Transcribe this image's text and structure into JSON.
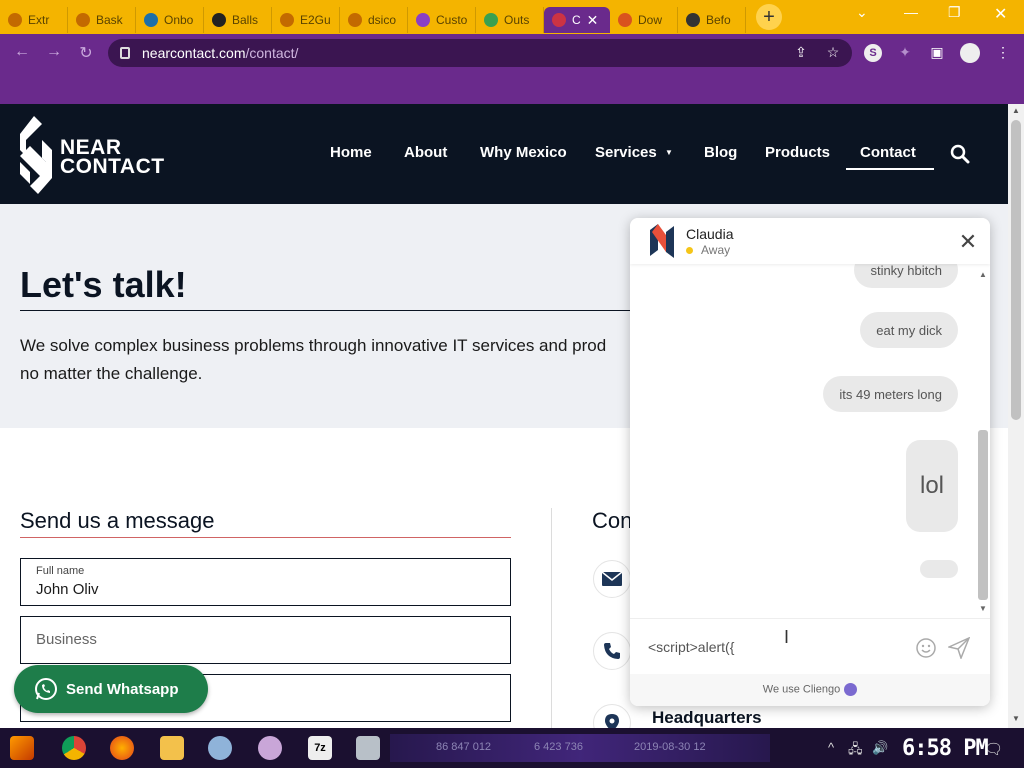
{
  "browser": {
    "tabs": [
      {
        "label": "Extr",
        "icon": "globe-icon",
        "color": "#c36a00"
      },
      {
        "label": "Bask",
        "icon": "globe-icon",
        "color": "#c36a00"
      },
      {
        "label": "Onbo",
        "icon": "s-logo-icon",
        "color": "#1d6fa8"
      },
      {
        "label": "Balls",
        "icon": "terminal-icon",
        "color": "#222"
      },
      {
        "label": "E2Gu",
        "icon": "globe-icon",
        "color": "#c36a00"
      },
      {
        "label": "dsico",
        "icon": "globe-icon",
        "color": "#c36a00"
      },
      {
        "label": "Custo",
        "icon": "puzzle-icon",
        "color": "#8a3fc4"
      },
      {
        "label": "Outs",
        "icon": "search-icon",
        "color": "#3aa050"
      },
      {
        "label": "C",
        "icon": "nearcontact-icon",
        "color": "#cc3344",
        "active": true
      },
      {
        "label": "Dow",
        "icon": "brave-icon",
        "color": "#d9531e"
      },
      {
        "label": "Befo",
        "icon": "shield-icon",
        "color": "#333"
      }
    ],
    "new_tab": "+",
    "url_host": "nearcontact.com",
    "url_path": "/contact/"
  },
  "site": {
    "logo_line1": "NEAR",
    "logo_line2": "CONTACT",
    "nav": [
      "Home",
      "About",
      "Why Mexico",
      "Services",
      "Blog",
      "Products",
      "Contact"
    ],
    "active_nav": "Contact"
  },
  "hero": {
    "title": "Let's talk!",
    "text_line1": "We solve complex business problems through innovative IT services and prod",
    "text_line2": "no matter the challenge."
  },
  "form": {
    "section_title": "Send us a message",
    "contact_title": "Con",
    "fullname_label": "Full name",
    "fullname_value": "John Oliv",
    "business_placeholder": "Business",
    "hq_label": "Headquarters"
  },
  "whatsapp": {
    "label": "Send Whatsapp"
  },
  "chat": {
    "agent_name": "Claudia",
    "agent_status": "Away",
    "messages": [
      {
        "text": "stinky hbitch"
      },
      {
        "text": "eat my dick"
      },
      {
        "text": "its 49 meters long"
      },
      {
        "text": "lol"
      },
      {
        "text": ""
      }
    ],
    "input_value": "<script>alert({",
    "powered_by": "We use Cliengo"
  },
  "taskbar": {
    "faint_texts": [
      "86 847 012",
      "6 423 736",
      "2019-08-30 12"
    ],
    "clock": "6:58 PM"
  }
}
